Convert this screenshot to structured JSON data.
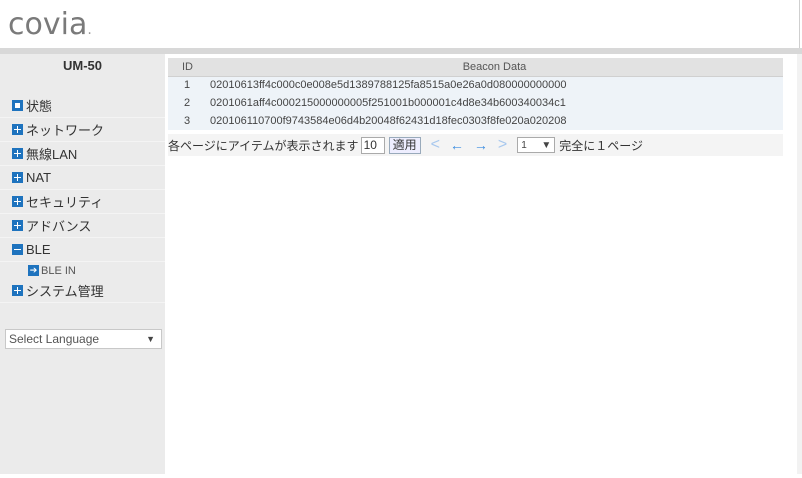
{
  "header": {
    "logo_text": "covia",
    "logo_dot": "."
  },
  "sidebar": {
    "model": "UM-50",
    "items": [
      {
        "label": "状態",
        "icon": "box-icon"
      },
      {
        "label": "ネットワーク",
        "icon": "plus-icon"
      },
      {
        "label": "無線LAN",
        "icon": "plus-icon"
      },
      {
        "label": "NAT",
        "icon": "plus-icon"
      },
      {
        "label": "セキュリティ",
        "icon": "plus-icon"
      },
      {
        "label": "アドバンス",
        "icon": "plus-icon"
      },
      {
        "label": "BLE",
        "icon": "minus-icon"
      }
    ],
    "subitem": {
      "label": "BLE IN",
      "icon": "arrow-right-icon"
    },
    "last_item": {
      "label": "システム管理",
      "icon": "plus-icon"
    },
    "language": {
      "selected": "Select Language"
    }
  },
  "table": {
    "headers": [
      "ID",
      "Beacon Data"
    ],
    "rows": [
      {
        "id": "1",
        "data": "02010613ff4c000c0e008e5d1389788125fa8515a0e26a0d080000000000"
      },
      {
        "id": "2",
        "data": "0201061aff4c000215000000005f251001b000001c4d8e34b600340034c1"
      },
      {
        "id": "3",
        "data": "020106110700f9743584e06d4b20048f62431d18fec0303f8fe020a020208"
      }
    ]
  },
  "pager": {
    "prefix": "各ページにアイテムが表示されます",
    "per_page": "10",
    "apply_label": "適用",
    "first": "<",
    "prev": "←",
    "next": "→",
    "last": ">",
    "page": "1",
    "total": "完全に１ページ"
  }
}
